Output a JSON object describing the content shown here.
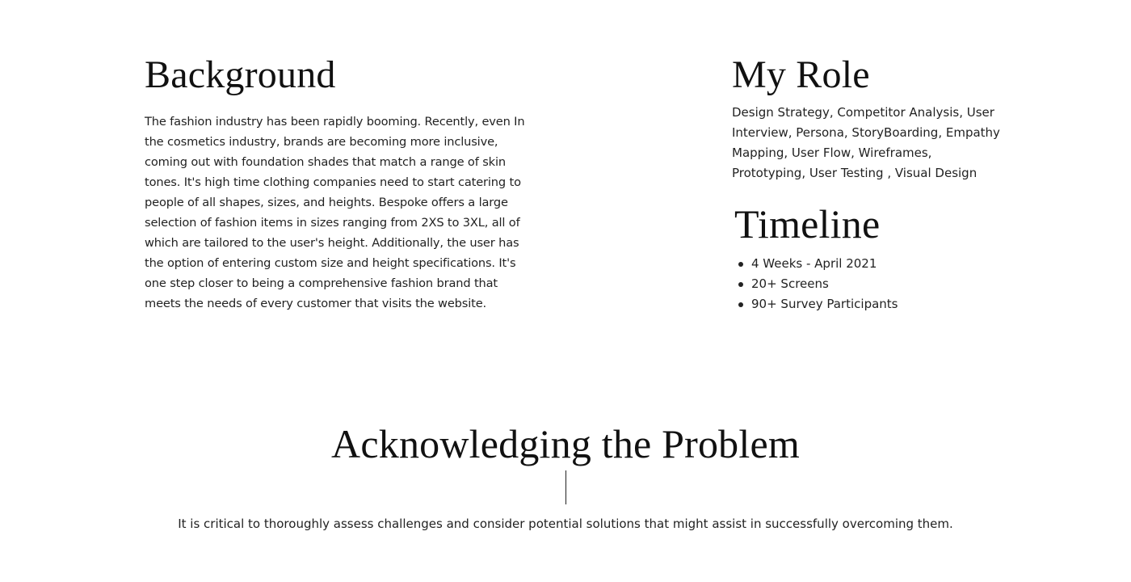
{
  "background": {
    "title": "Background",
    "body": "The fashion industry has been rapidly booming. Recently, even In the cosmetics industry, brands are becoming more inclusive, coming out with foundation shades that match a range of skin tones. It's high time clothing companies need to start catering to people of all shapes, sizes, and heights. Bespoke offers a large selection of fashion items in sizes ranging from 2XS to 3XL, all of which are tailored to the user's height. Additionally, the user has the option of entering custom size and height specifications. It's one step closer to being a comprehensive fashion brand that meets the needs of every customer that visits the website."
  },
  "role": {
    "title": "My Role",
    "body": "Design Strategy, Competitor Analysis, User Interview, Persona, StoryBoarding, Empathy Mapping, User Flow, Wireframes, Prototyping, User Testing , Visual Design"
  },
  "timeline": {
    "title": "Timeline",
    "items": [
      "4 Weeks - April 2021",
      "20+ Screens",
      "90+ Survey Participants"
    ]
  },
  "problem": {
    "title": "Acknowledging the Problem",
    "body": "It is critical to thoroughly assess challenges and consider potential solutions that might assist in successfully overcoming them."
  }
}
